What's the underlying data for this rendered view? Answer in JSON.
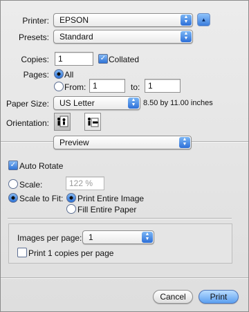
{
  "printer": {
    "label": "Printer:",
    "value": "EPSON"
  },
  "presets": {
    "label": "Presets:",
    "value": "Standard"
  },
  "copies": {
    "label": "Copies:",
    "value": "1",
    "collated_label": "Collated",
    "collated": true
  },
  "pages": {
    "label": "Pages:",
    "all_label": "All",
    "from_label": "From:",
    "from_value": "1",
    "to_label": "to:",
    "to_value": "1"
  },
  "paper": {
    "label": "Paper Size:",
    "value": "US Letter",
    "size_text": "8.50 by 11.00 inches"
  },
  "orientation": {
    "label": "Orientation:",
    "selected": "portrait"
  },
  "section": {
    "value": "Preview"
  },
  "preview": {
    "auto_rotate_label": "Auto Rotate",
    "auto_rotate": true,
    "scale_label": "Scale:",
    "scale_value": "122 %",
    "scale_to_fit_label": "Scale to Fit:",
    "print_entire_label": "Print Entire Image",
    "fill_entire_label": "Fill Entire Paper"
  },
  "layout": {
    "images_per_page_label": "Images per page:",
    "images_per_page_value": "1",
    "print_copies_label": "Print 1 copies per page"
  },
  "buttons": {
    "cancel": "Cancel",
    "print": "Print"
  },
  "colors": {
    "accent": "#2d6fd8",
    "dialog_bg": "#e6e6e6"
  }
}
